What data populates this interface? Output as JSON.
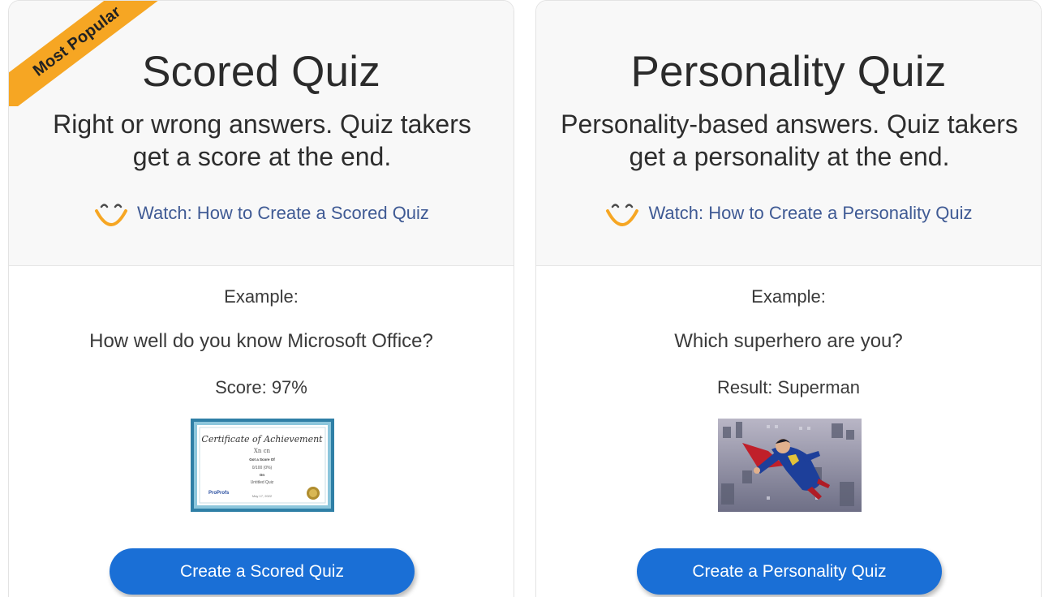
{
  "colors": {
    "accent": "#1a6fd6",
    "link": "#3f5a94",
    "ribbon": "#f6a623",
    "smile": "#f6a623",
    "top_panel": "#f8f8f8"
  },
  "cards": [
    {
      "ribbon": "Most Popular",
      "title": "Scored Quiz",
      "description": "Right or wrong answers. Quiz takers get a score at the end.",
      "watch_icon": "smile-icon",
      "watch_label": "Watch: How to Create a Scored Quiz",
      "example_label": "Example:",
      "example_question": "How well do you know Microsoft Office?",
      "example_result": "Score: 97%",
      "thumbnail": {
        "title": "Certificate of Achievement",
        "name": "Xn cn",
        "line1": "Got a Score Of",
        "score": "0/100 (0%)",
        "line2": "On",
        "quiz": "Untitled Quiz",
        "brand": "ProProfs",
        "date": "May 17, 2022"
      },
      "button_label": "Create a Scored Quiz"
    },
    {
      "title": "Personality Quiz",
      "description": "Personality-based answers. Quiz takers get a personality at the end.",
      "watch_icon": "smile-icon",
      "watch_label": "Watch: How to Create a Personality Quiz",
      "example_label": "Example:",
      "example_question": "Which superhero are you?",
      "example_result": "Result: Superman",
      "button_label": "Create a Personality Quiz"
    }
  ]
}
